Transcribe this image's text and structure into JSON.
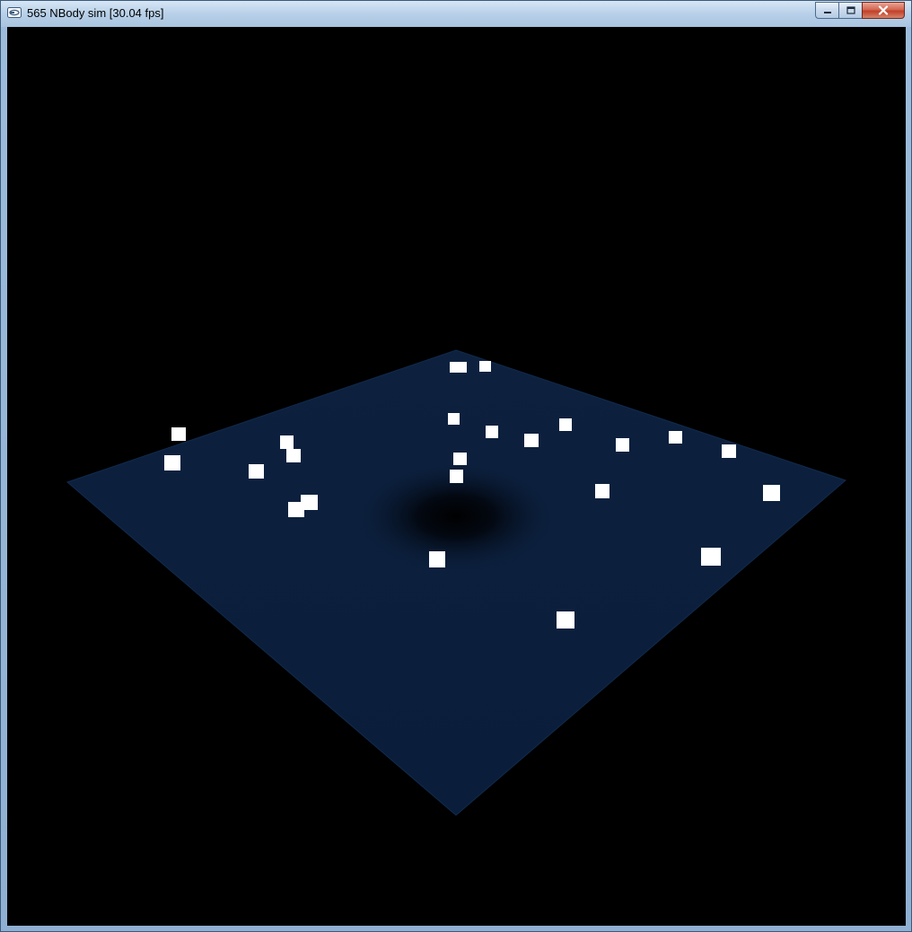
{
  "window": {
    "title": "565 NBody sim [30.04 fps]",
    "icon": "app-window-icon",
    "controls": {
      "minimize_icon": "minimize-icon",
      "maximize_icon": "maximize-icon",
      "close_icon": "close-icon"
    }
  },
  "scene": {
    "background_color": "#000000",
    "plane_color": "#0b1f3d",
    "plane_edge_color": "#102848",
    "well_color": "#000000",
    "body_color": "#ffffff",
    "body_count": 23
  }
}
